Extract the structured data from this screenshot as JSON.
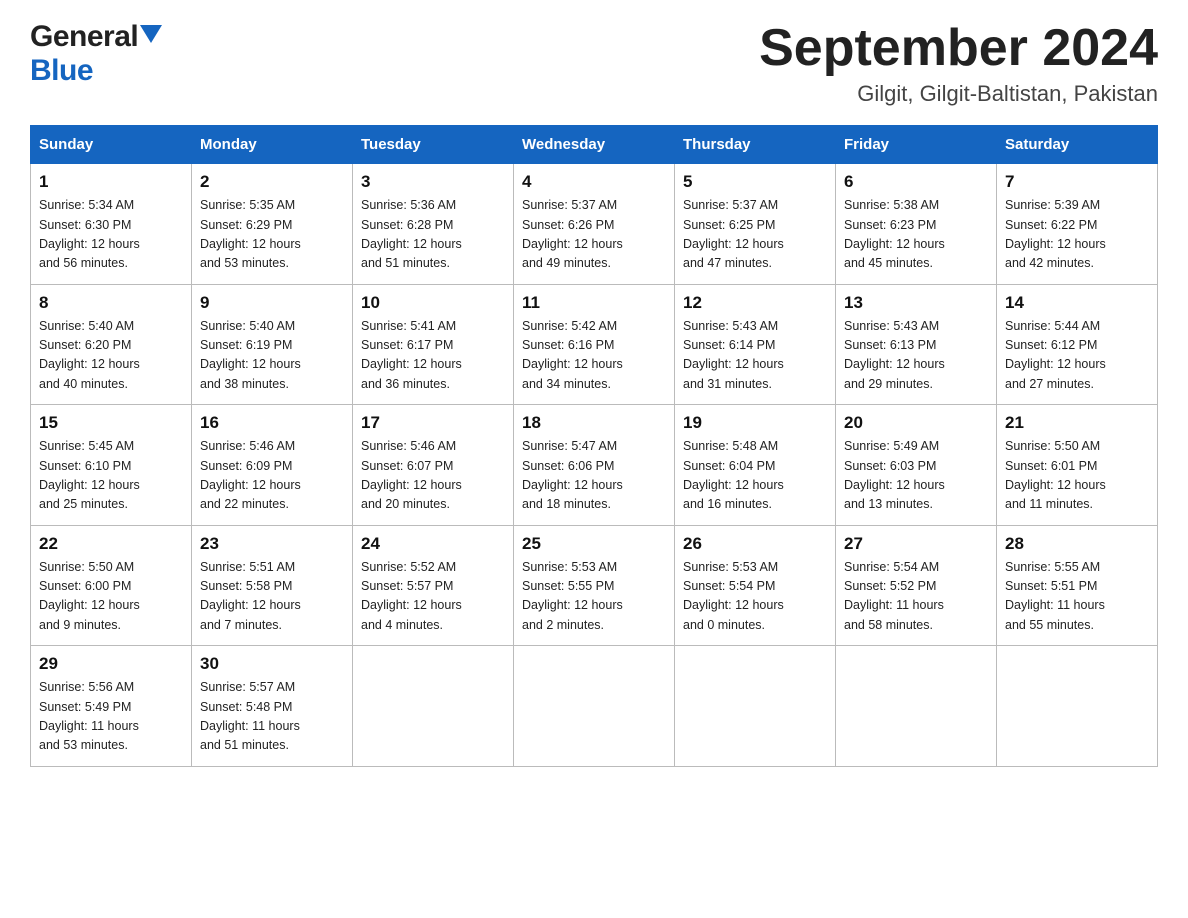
{
  "logo": {
    "general": "General",
    "blue": "Blue"
  },
  "title": {
    "month_year": "September 2024",
    "location": "Gilgit, Gilgit-Baltistan, Pakistan"
  },
  "days_of_week": [
    "Sunday",
    "Monday",
    "Tuesday",
    "Wednesday",
    "Thursday",
    "Friday",
    "Saturday"
  ],
  "weeks": [
    [
      {
        "day": "1",
        "sunrise": "Sunrise: 5:34 AM",
        "sunset": "Sunset: 6:30 PM",
        "daylight": "Daylight: 12 hours and 56 minutes."
      },
      {
        "day": "2",
        "sunrise": "Sunrise: 5:35 AM",
        "sunset": "Sunset: 6:29 PM",
        "daylight": "Daylight: 12 hours and 53 minutes."
      },
      {
        "day": "3",
        "sunrise": "Sunrise: 5:36 AM",
        "sunset": "Sunset: 6:28 PM",
        "daylight": "Daylight: 12 hours and 51 minutes."
      },
      {
        "day": "4",
        "sunrise": "Sunrise: 5:37 AM",
        "sunset": "Sunset: 6:26 PM",
        "daylight": "Daylight: 12 hours and 49 minutes."
      },
      {
        "day": "5",
        "sunrise": "Sunrise: 5:37 AM",
        "sunset": "Sunset: 6:25 PM",
        "daylight": "Daylight: 12 hours and 47 minutes."
      },
      {
        "day": "6",
        "sunrise": "Sunrise: 5:38 AM",
        "sunset": "Sunset: 6:23 PM",
        "daylight": "Daylight: 12 hours and 45 minutes."
      },
      {
        "day": "7",
        "sunrise": "Sunrise: 5:39 AM",
        "sunset": "Sunset: 6:22 PM",
        "daylight": "Daylight: 12 hours and 42 minutes."
      }
    ],
    [
      {
        "day": "8",
        "sunrise": "Sunrise: 5:40 AM",
        "sunset": "Sunset: 6:20 PM",
        "daylight": "Daylight: 12 hours and 40 minutes."
      },
      {
        "day": "9",
        "sunrise": "Sunrise: 5:40 AM",
        "sunset": "Sunset: 6:19 PM",
        "daylight": "Daylight: 12 hours and 38 minutes."
      },
      {
        "day": "10",
        "sunrise": "Sunrise: 5:41 AM",
        "sunset": "Sunset: 6:17 PM",
        "daylight": "Daylight: 12 hours and 36 minutes."
      },
      {
        "day": "11",
        "sunrise": "Sunrise: 5:42 AM",
        "sunset": "Sunset: 6:16 PM",
        "daylight": "Daylight: 12 hours and 34 minutes."
      },
      {
        "day": "12",
        "sunrise": "Sunrise: 5:43 AM",
        "sunset": "Sunset: 6:14 PM",
        "daylight": "Daylight: 12 hours and 31 minutes."
      },
      {
        "day": "13",
        "sunrise": "Sunrise: 5:43 AM",
        "sunset": "Sunset: 6:13 PM",
        "daylight": "Daylight: 12 hours and 29 minutes."
      },
      {
        "day": "14",
        "sunrise": "Sunrise: 5:44 AM",
        "sunset": "Sunset: 6:12 PM",
        "daylight": "Daylight: 12 hours and 27 minutes."
      }
    ],
    [
      {
        "day": "15",
        "sunrise": "Sunrise: 5:45 AM",
        "sunset": "Sunset: 6:10 PM",
        "daylight": "Daylight: 12 hours and 25 minutes."
      },
      {
        "day": "16",
        "sunrise": "Sunrise: 5:46 AM",
        "sunset": "Sunset: 6:09 PM",
        "daylight": "Daylight: 12 hours and 22 minutes."
      },
      {
        "day": "17",
        "sunrise": "Sunrise: 5:46 AM",
        "sunset": "Sunset: 6:07 PM",
        "daylight": "Daylight: 12 hours and 20 minutes."
      },
      {
        "day": "18",
        "sunrise": "Sunrise: 5:47 AM",
        "sunset": "Sunset: 6:06 PM",
        "daylight": "Daylight: 12 hours and 18 minutes."
      },
      {
        "day": "19",
        "sunrise": "Sunrise: 5:48 AM",
        "sunset": "Sunset: 6:04 PM",
        "daylight": "Daylight: 12 hours and 16 minutes."
      },
      {
        "day": "20",
        "sunrise": "Sunrise: 5:49 AM",
        "sunset": "Sunset: 6:03 PM",
        "daylight": "Daylight: 12 hours and 13 minutes."
      },
      {
        "day": "21",
        "sunrise": "Sunrise: 5:50 AM",
        "sunset": "Sunset: 6:01 PM",
        "daylight": "Daylight: 12 hours and 11 minutes."
      }
    ],
    [
      {
        "day": "22",
        "sunrise": "Sunrise: 5:50 AM",
        "sunset": "Sunset: 6:00 PM",
        "daylight": "Daylight: 12 hours and 9 minutes."
      },
      {
        "day": "23",
        "sunrise": "Sunrise: 5:51 AM",
        "sunset": "Sunset: 5:58 PM",
        "daylight": "Daylight: 12 hours and 7 minutes."
      },
      {
        "day": "24",
        "sunrise": "Sunrise: 5:52 AM",
        "sunset": "Sunset: 5:57 PM",
        "daylight": "Daylight: 12 hours and 4 minutes."
      },
      {
        "day": "25",
        "sunrise": "Sunrise: 5:53 AM",
        "sunset": "Sunset: 5:55 PM",
        "daylight": "Daylight: 12 hours and 2 minutes."
      },
      {
        "day": "26",
        "sunrise": "Sunrise: 5:53 AM",
        "sunset": "Sunset: 5:54 PM",
        "daylight": "Daylight: 12 hours and 0 minutes."
      },
      {
        "day": "27",
        "sunrise": "Sunrise: 5:54 AM",
        "sunset": "Sunset: 5:52 PM",
        "daylight": "Daylight: 11 hours and 58 minutes."
      },
      {
        "day": "28",
        "sunrise": "Sunrise: 5:55 AM",
        "sunset": "Sunset: 5:51 PM",
        "daylight": "Daylight: 11 hours and 55 minutes."
      }
    ],
    [
      {
        "day": "29",
        "sunrise": "Sunrise: 5:56 AM",
        "sunset": "Sunset: 5:49 PM",
        "daylight": "Daylight: 11 hours and 53 minutes."
      },
      {
        "day": "30",
        "sunrise": "Sunrise: 5:57 AM",
        "sunset": "Sunset: 5:48 PM",
        "daylight": "Daylight: 11 hours and 51 minutes."
      },
      null,
      null,
      null,
      null,
      null
    ]
  ]
}
